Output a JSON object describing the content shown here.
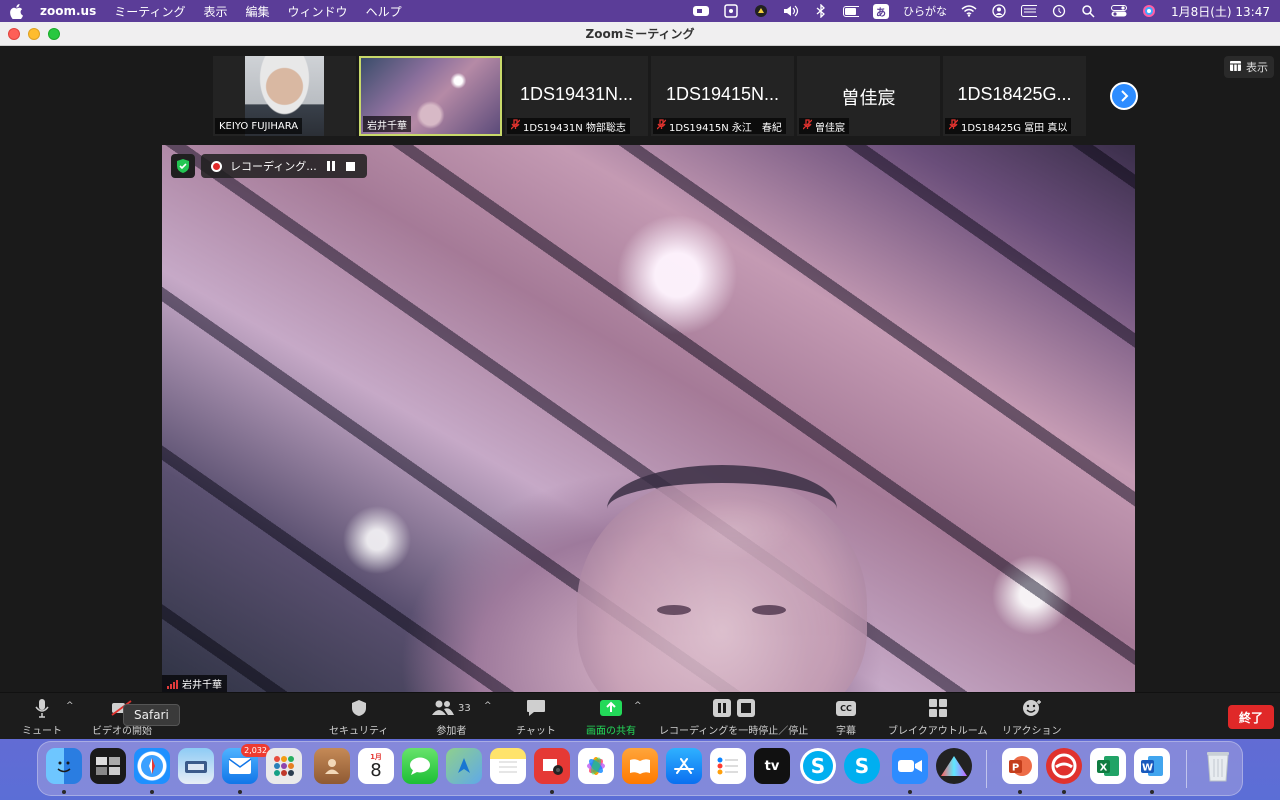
{
  "menubar": {
    "app_name": "zoom.us",
    "menus": [
      "ミーティング",
      "表示",
      "編集",
      "ウィンドウ",
      "ヘルプ"
    ],
    "ime_label": "あ",
    "ime_mode": "ひらがな",
    "clock": "1月8日(土)  13:47"
  },
  "window": {
    "title": "Zoomミーティング",
    "view_label": "表示"
  },
  "thumbnails": [
    {
      "big_name": "",
      "label": "KEIYO FUJIHARA",
      "muted": false
    },
    {
      "big_name": "",
      "label": "岩井千華",
      "muted": false
    },
    {
      "big_name": "1DS19431N...",
      "label": "1DS19431N 物部聡志",
      "muted": true
    },
    {
      "big_name": "1DS19415N...",
      "label": "1DS19415N 永江　春紀",
      "muted": true
    },
    {
      "big_name": "曽佳宸",
      "label": "曽佳宸",
      "muted": true
    },
    {
      "big_name": "1DS18425G...",
      "label": "1DS18425G 冨田 真以",
      "muted": true
    }
  ],
  "main_video": {
    "recording_label": "レコーディング...",
    "speaker_name": "岩井千華"
  },
  "toolbar": {
    "mute": "ミュート",
    "video": "ビデオの開始",
    "security": "セキュリティ",
    "participants": "参加者",
    "participants_count": "33",
    "chat": "チャット",
    "share": "画面の共有",
    "recording": "レコーディングを一時停止／停止",
    "cc": "字幕",
    "cc_icon_text": "CC",
    "breakout": "ブレイクアウトルーム",
    "reaction": "リアクション",
    "end": "終了"
  },
  "tooltip": "Safari",
  "dock": {
    "mail_badge": "2,032",
    "calendar_month": "1月",
    "calendar_day": "8",
    "tv_label": "tv"
  },
  "colors": {
    "accent_blue": "#2d8cff",
    "share_green": "#23d959",
    "end_red": "#e02828",
    "muted_red": "#e0322e",
    "active_border": "#c8d96a"
  }
}
